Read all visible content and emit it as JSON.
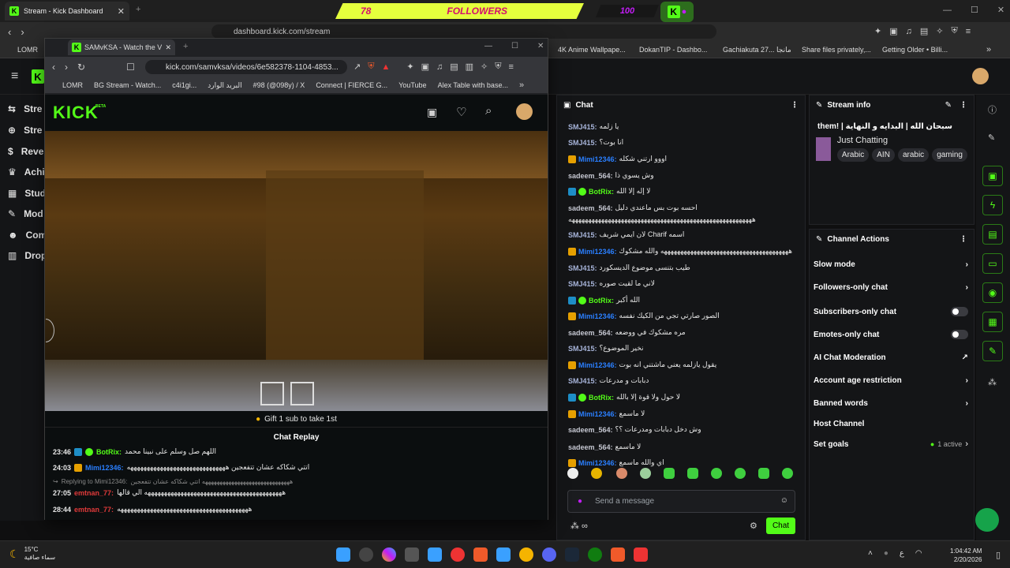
{
  "back_browser": {
    "tab_title": "Stream - Kick Dashboard",
    "url": "dashboard.kick.com/stream",
    "bookmarks": [
      "LOMR",
      "4K Anime Wallpape...",
      "DokanTIP - Dashbo...",
      "Gachiakuta 27... مانجا",
      "Share files privately,...",
      "Getting Older • Billi..."
    ]
  },
  "banner": {
    "count": "78",
    "label": "FOLLOWERS",
    "goal": "100"
  },
  "nav": {
    "items": [
      "Stre",
      "Stre",
      "Reve",
      "Achi",
      "Stud",
      "Mod",
      "Com",
      "Drop"
    ]
  },
  "popup": {
    "tab_title": "SAMvKSA - Watch the VOD o",
    "url": "kick.com/samvksa/videos/6e582378-1104-4853...",
    "bookmarks": [
      "LOMR",
      "BG Stream - Watch...",
      "c4i1gi...",
      "البريد الوارد",
      "#98 (@098y) / X",
      "Connect | FIERCE G...",
      "YouTube",
      "Alex Table with base..."
    ],
    "logo": "KICK",
    "beta": "BETA",
    "gift_text": "Gift 1 sub to take 1st",
    "replay_title": "Chat Replay",
    "replay": [
      {
        "time": "23:46",
        "user": "BotRix:",
        "text": "اللهم صل وسلم على نبينا محمد"
      },
      {
        "time": "24:03",
        "user": "Mimi12346:",
        "text": "اتتي شكاكه عشان تتفعجين ههههههههههههههههههههههههههههههه"
      },
      {
        "time": "",
        "user": "Replying to Mimi12346:",
        "text": "ههههههههههههههههههههههههههههههه اتتي شكاكه عشان تتفعجين"
      },
      {
        "time": "27:05",
        "user": "emtnan_77:",
        "text": "ههههههههههههههههههههههههههههههههههههههههههه الي قالها"
      },
      {
        "time": "28:44",
        "user": "emtnan_77:",
        "text": "ههههههههههههههههههههههههههههههههههههههههه"
      }
    ]
  },
  "chat": {
    "title": "Chat",
    "messages": [
      {
        "user": "SMJ415:",
        "text": "يا زلمه",
        "badge": "none",
        "style": "u1"
      },
      {
        "user": "SMJ415:",
        "text": "انا بوت؟",
        "badge": "none",
        "style": "u1"
      },
      {
        "user": "Mimi12346:",
        "text": "اووو ارتني شكله",
        "badge": "crown",
        "style": "u2"
      },
      {
        "user": "sadeem_564:",
        "text": "وش يسوي ذا",
        "badge": "none",
        "style": "u3"
      },
      {
        "user": "BotRix:",
        "text": "لا إله إلا الله",
        "badge": "bot",
        "style": "u4"
      },
      {
        "user": "sadeem_564:",
        "text": "احسه بوت بس ماعندي دليل",
        "badge": "none",
        "style": "u3"
      },
      {
        "user": "",
        "text": "ههههههههههههههههههههههههههههههههههههههههههههههههههههههههه",
        "badge": "none",
        "style": "u3"
      },
      {
        "user": "SMJ415:",
        "text": "لان ايمي شريف Charif اسمه",
        "badge": "none",
        "style": "u1"
      },
      {
        "user": "Mimi12346:",
        "text": "هههههههههههههههههههههههههههههههههههههههه والله مشكوك",
        "badge": "crown",
        "style": "u2"
      },
      {
        "user": "SMJ415:",
        "text": "طيب بتنسى موضوع الديسكورد",
        "badge": "none",
        "style": "u1"
      },
      {
        "user": "SMJ415:",
        "text": "لاني ما لقيت صوره",
        "badge": "none",
        "style": "u1"
      },
      {
        "user": "BotRix:",
        "text": "الله أكبر",
        "badge": "bot",
        "style": "u4"
      },
      {
        "user": "Mimi12346:",
        "text": "الصور صارتي تجي من الكيك نفسه",
        "badge": "crown",
        "style": "u2"
      },
      {
        "user": "sadeem_564:",
        "text": "مره مشكوك في ووضعه",
        "badge": "none",
        "style": "u3"
      },
      {
        "user": "SMJ415:",
        "text": "نخير الموضوع؟",
        "badge": "none",
        "style": "u1"
      },
      {
        "user": "Mimi12346:",
        "text": "يقول يازلمه يعني ماشتني انه بوت",
        "badge": "crown",
        "style": "u2"
      },
      {
        "user": "SMJ415:",
        "text": "دبابات و مدرعات",
        "badge": "none",
        "style": "u1"
      },
      {
        "user": "BotRix:",
        "text": "لا حول ولا قوة إلا بالله",
        "badge": "bot",
        "style": "u4"
      },
      {
        "user": "Mimi12346:",
        "text": "لا ماسمع",
        "badge": "crown",
        "style": "u2"
      },
      {
        "user": "sadeem_564:",
        "text": "وش دخل دبابات ومدرعات ؟؟",
        "badge": "none",
        "style": "u3"
      },
      {
        "user": "sadeem_564:",
        "text": "لا ماسمع",
        "badge": "none",
        "style": "u3"
      },
      {
        "user": "Mimi12346:",
        "text": "اي والله ماسمع",
        "badge": "crown",
        "style": "u2"
      }
    ],
    "input_placeholder": "Send a message",
    "send_label": "Chat"
  },
  "stream_info": {
    "title_label": "Stream info",
    "stream_title": "سبحان الله | البدايه و النهاية | !them",
    "category": "Just Chatting",
    "tags": [
      "Arabic",
      "AIN",
      "arabic",
      "gaming"
    ]
  },
  "channel_actions": {
    "title": "Channel Actions",
    "items": [
      "Slow mode",
      "Followers-only chat",
      "Subscribers-only chat",
      "Emotes-only chat",
      "AI Chat Moderation",
      "Account age restriction",
      "Banned words",
      "Host Channel",
      "Set goals"
    ],
    "goals_status": "1 active"
  },
  "taskbar": {
    "weather_temp": "15°C",
    "weather_desc": "سماء صافية",
    "time": "1:04:42 AM",
    "date": "2/20/2026",
    "lang": "ع"
  },
  "colors": {
    "kick_green": "#53fc18",
    "banner_yellow": "#e5ff3d",
    "banner_pink": "#d40d6e"
  }
}
